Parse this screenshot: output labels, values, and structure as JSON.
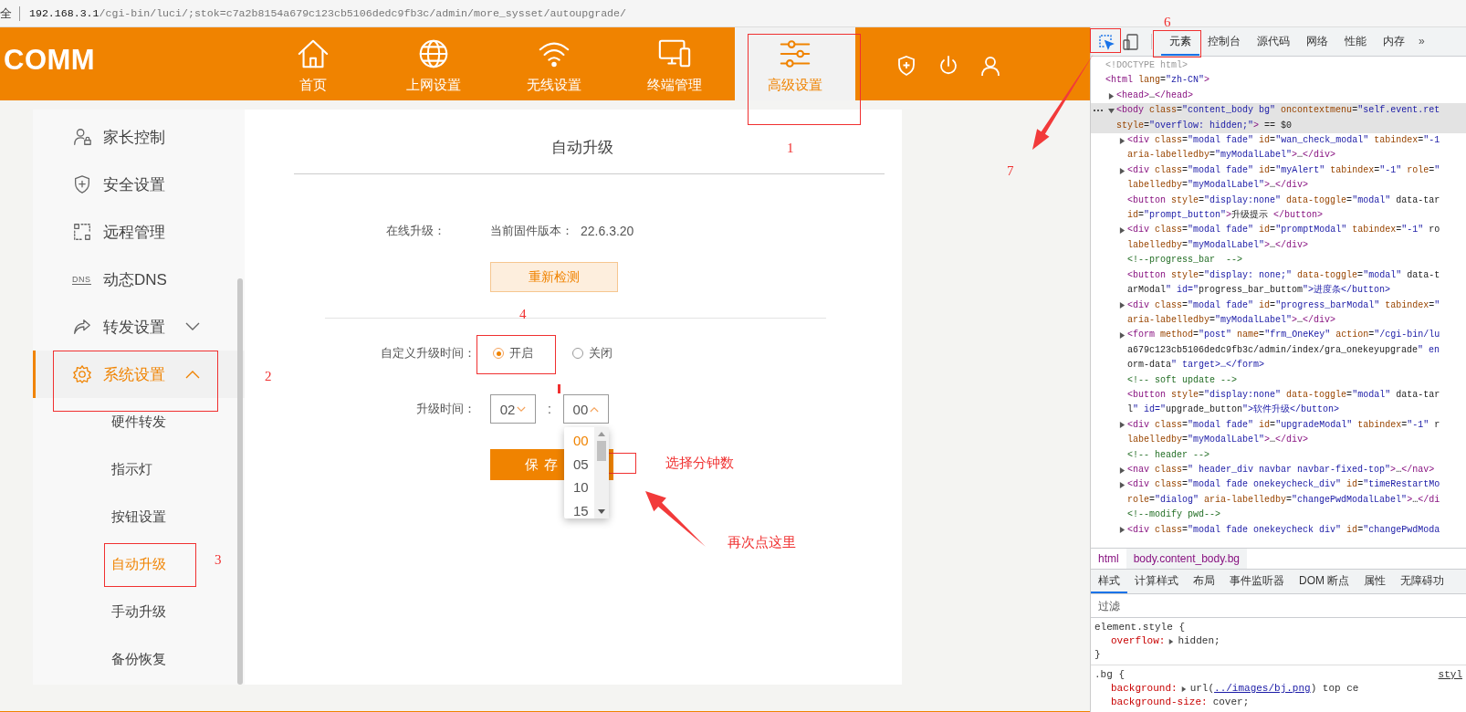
{
  "address_bar": {
    "prefix": "全",
    "host": "192.168.3.1",
    "path": "/cgi-bin/luci/;stok=c7a2b8154a679c123cb5106dedc9fb3c/admin/more_sysset/autoupgrade/"
  },
  "header": {
    "logo": "COMM",
    "nav": [
      {
        "label": "首页",
        "kind": "home",
        "selected": false
      },
      {
        "label": "上网设置",
        "kind": "globe",
        "selected": false
      },
      {
        "label": "无线设置",
        "kind": "wifi",
        "selected": false
      },
      {
        "label": "终端管理",
        "kind": "devices",
        "selected": false
      },
      {
        "label": "高级设置",
        "kind": "sliders",
        "selected": true
      }
    ]
  },
  "sidebar": {
    "items": [
      {
        "label": "家长控制",
        "kind": "parent",
        "selected": false
      },
      {
        "label": "安全设置",
        "kind": "shield",
        "selected": false
      },
      {
        "label": "远程管理",
        "kind": "remote",
        "selected": false
      },
      {
        "label": "动态DNS",
        "kind": "dns",
        "icon_text": "DNS",
        "selected": false
      },
      {
        "label": "转发设置",
        "kind": "forward",
        "expanded": false,
        "selected": false
      },
      {
        "label": "系统设置",
        "kind": "gear",
        "expanded": true,
        "selected": true,
        "children": [
          {
            "label": "硬件转发",
            "selected": false
          },
          {
            "label": "指示灯",
            "selected": false
          },
          {
            "label": "按钮设置",
            "selected": false
          },
          {
            "label": "自动升级",
            "selected": true
          },
          {
            "label": "手动升级",
            "selected": false
          },
          {
            "label": "备份恢复",
            "selected": false
          }
        ]
      }
    ]
  },
  "content": {
    "title": "自动升级",
    "online_label": "在线升级：",
    "firmware_label": "当前固件版本：",
    "firmware_version": "22.6.3.20",
    "recheck_button": "重新检测",
    "schedule_label": "自定义升级时间：",
    "schedule_options": [
      {
        "label": "开启",
        "selected": true
      },
      {
        "label": "关闭",
        "selected": false
      }
    ],
    "time_label": "升级时间：",
    "hour": {
      "value": "02",
      "expanded": false
    },
    "time_separator": ":",
    "minute": {
      "value": "00",
      "expanded": true,
      "options": [
        {
          "label": "00",
          "selected": true
        },
        {
          "label": "05",
          "selected": false
        },
        {
          "label": "10",
          "selected": false
        },
        {
          "label": "15",
          "selected": false
        }
      ]
    },
    "save_button": "保存"
  },
  "annotations": [
    {
      "kind": "box"
    },
    {
      "kind": "label",
      "text": "1"
    },
    {
      "kind": "box"
    },
    {
      "kind": "label",
      "text": "2"
    },
    {
      "kind": "box"
    },
    {
      "kind": "label",
      "text": "3"
    },
    {
      "kind": "box"
    },
    {
      "kind": "label",
      "text": "4"
    },
    {
      "kind": "tick"
    },
    {
      "kind": "box"
    },
    {
      "kind": "label",
      "text": "选择分钟数"
    },
    {
      "kind": "arrow"
    },
    {
      "kind": "label",
      "text": "再次点这里"
    },
    {
      "kind": "label",
      "text": "6"
    },
    {
      "kind": "box"
    },
    {
      "kind": "box"
    },
    {
      "kind": "arrow"
    },
    {
      "kind": "label",
      "text": "7"
    }
  ],
  "devtools": {
    "inspect_mode": true,
    "tabs": [
      {
        "label": "元素",
        "selected": true
      },
      {
        "label": "控制台",
        "selected": false
      },
      {
        "label": "源代码",
        "selected": false
      },
      {
        "label": "网络",
        "selected": false
      },
      {
        "label": "性能",
        "selected": false
      },
      {
        "label": "内存",
        "selected": false
      }
    ],
    "more_tabs": "»",
    "dom": [
      {
        "kind": "doctype",
        "selected": false,
        "lines": [
          "<!DOCTYPE html>"
        ]
      },
      {
        "kind": "element",
        "selected": false,
        "lines": [
          "<html lang=\"zh-CN\">"
        ],
        "children": [
          {
            "kind": "element",
            "selected": false,
            "expanded": false,
            "lines": [
              "<head>…</head>"
            ]
          },
          {
            "kind": "element",
            "selected": true,
            "expanded": true,
            "lines": [
              "<body class=\"content_body bg\" oncontextmenu=\"self.event.ret",
              "style=\"overflow: hidden;\"> == $0"
            ],
            "children": [
              {
                "kind": "element",
                "selected": false,
                "expanded": false,
                "lines": [
                  "<div class=\"modal fade\" id=\"wan_check_modal\" tabindex=\"-1",
                  "aria-labelledby=\"myModalLabel\">…</div>"
                ]
              },
              {
                "kind": "element",
                "selected": false,
                "expanded": false,
                "lines": [
                  "<div class=\"modal fade\" id=\"myAlert\" tabindex=\"-1\" role=\"",
                  "labelledby=\"myModalLabel\">…</div>"
                ]
              },
              {
                "kind": "element",
                "selected": false,
                "lines": [
                  "<button style=\"display:none\" data-toggle=\"modal\" data-tar",
                  "id=\"prompt_button\">升级提示 </button>"
                ]
              },
              {
                "kind": "element",
                "selected": false,
                "expanded": false,
                "lines": [
                  "<div class=\"modal fade\" id=\"promptModal\" tabindex=\"-1\" ro",
                  "labelledby=\"myModalLabel\">…</div>"
                ]
              },
              {
                "kind": "comment",
                "selected": false,
                "lines": [
                  "<!--progress_bar  -->"
                ]
              },
              {
                "kind": "element",
                "selected": false,
                "lines": [
                  "<button style=\"display: none;\" data-toggle=\"modal\" data-t",
                  "arModal\" id=\"progress_bar_buttom\">进度条</button>"
                ]
              },
              {
                "kind": "element",
                "selected": false,
                "expanded": false,
                "lines": [
                  "<div class=\"modal fade\" id=\"progress_barModal\" tabindex=\"",
                  "aria-labelledby=\"myModalLabel\">…</div>"
                ]
              },
              {
                "kind": "element",
                "selected": false,
                "expanded": false,
                "lines": [
                  "<form method=\"post\" name=\"frm_OneKey\" action=\"/cgi-bin/lu",
                  "a679c123cb5106dedc9fb3c/admin/index/gra_onekeyupgrade\" en",
                  "orm-data\" target>…</form>"
                ]
              },
              {
                "kind": "comment",
                "selected": false,
                "lines": [
                  "<!-- soft update -->"
                ]
              },
              {
                "kind": "element",
                "selected": false,
                "lines": [
                  "<button style=\"display:none\" data-toggle=\"modal\" data-tar",
                  "l\" id=\"upgrade_button\">软件升级</button>"
                ]
              },
              {
                "kind": "element",
                "selected": false,
                "expanded": false,
                "lines": [
                  "<div class=\"modal fade\" id=\"upgradeModal\" tabindex=\"-1\" r",
                  "labelledby=\"myModalLabel\">…</div>"
                ]
              },
              {
                "kind": "comment",
                "selected": false,
                "lines": [
                  "<!-- header -->"
                ]
              },
              {
                "kind": "element",
                "selected": false,
                "expanded": false,
                "lines": [
                  "<nav class=\" header_div navbar navbar-fixed-top\">…</nav>"
                ]
              },
              {
                "kind": "element",
                "selected": false,
                "expanded": false,
                "lines": [
                  "<div class=\"modal fade onekeycheck_div\" id=\"timeRestartMo",
                  "role=\"dialog\" aria-labelledby=\"changePwdModalLabel\">…</di"
                ]
              },
              {
                "kind": "comment",
                "selected": false,
                "lines": [
                  "<!--modify pwd-->"
                ]
              },
              {
                "kind": "element",
                "selected": false,
                "expanded": false,
                "lines": [
                  "<div class=\"modal fade onekeycheck div\" id=\"changePwdModa"
                ]
              }
            ]
          }
        ]
      }
    ],
    "breadcrumb": [
      {
        "label": "html",
        "selected": false
      },
      {
        "label": "body.content_body.bg",
        "selected": true
      }
    ],
    "style_tabs": [
      {
        "label": "样式",
        "selected": true
      },
      {
        "label": "计算样式",
        "selected": false
      },
      {
        "label": "布局",
        "selected": false
      },
      {
        "label": "事件监听器",
        "selected": false
      },
      {
        "label": "DOM 断点",
        "selected": false
      },
      {
        "label": "属性",
        "selected": false
      },
      {
        "label": "无障碍功",
        "selected": false
      }
    ],
    "filter": {
      "placeholder": "过滤"
    },
    "rules": [
      {
        "header": "element.style {",
        "declarations": [
          {
            "property": "overflow:",
            "expandable": true,
            "value": "hidden;"
          }
        ],
        "footer": "}"
      },
      {
        "header": ".bg {",
        "source": "styl",
        "declarations": [
          {
            "property": "background:",
            "expandable": true,
            "value": "url(",
            "link": "../images/bj.png",
            "value_after": ") top ce"
          },
          {
            "property": "background-size:",
            "expandable": false,
            "value": "cover;"
          }
        ]
      }
    ]
  }
}
